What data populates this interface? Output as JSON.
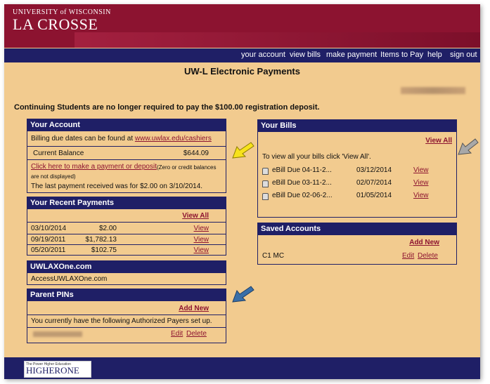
{
  "header": {
    "logo_top": "UNIVERSITY of WISCONSIN",
    "logo_main": "LA CROSSE"
  },
  "nav": [
    "your account",
    "view bills",
    "make payment",
    "Items to Pay",
    "help",
    "sign out"
  ],
  "page_title": "UW-L Electronic Payments",
  "notice": "Continuing Students are no longer required to pay the $100.00 registration deposit.",
  "your_account": {
    "title": "Your Account",
    "billing_prefix": "Billing due dates can be found at ",
    "billing_link": "www.uwlax.edu/cashiers",
    "balance_label": "Current Balance",
    "balance_value": "$644.09",
    "pay_link": "Click here to make a payment or deposit",
    "pay_note_1": "(Zero or credit balances",
    "pay_note_2": "are not displayed)",
    "last_payment": "The last payment received was for $2.00 on 3/10/2014."
  },
  "recent_payments": {
    "title": "Your Recent Payments",
    "view_all": "View All",
    "rows": [
      {
        "date": "03/10/2014",
        "amount": "$2.00",
        "action": "View"
      },
      {
        "date": "09/19/2011",
        "amount": "$1,782.13",
        "action": "View"
      },
      {
        "date": "05/20/2011",
        "amount": "$102.75",
        "action": "View"
      }
    ]
  },
  "uwlaxone": {
    "title": "UWLAXOne.com",
    "text": "AccessUWLAXOne.com"
  },
  "parent_pins": {
    "title": "Parent PINs",
    "add_new": "Add New",
    "text": "You currently have the following Authorized Payers set up.",
    "edit": "Edit",
    "delete": "Delete"
  },
  "your_bills": {
    "title": "Your Bills",
    "view_all": "View All",
    "intro": "To view all your bills click 'View All'.",
    "rows": [
      {
        "name": "eBill Due 04-11-2...",
        "date": "03/12/2014",
        "action": "View"
      },
      {
        "name": "eBill Due 03-11-2...",
        "date": "02/07/2014",
        "action": "View"
      },
      {
        "name": "eBill Due 02-06-2...",
        "date": "01/05/2014",
        "action": "View"
      }
    ]
  },
  "saved_accounts": {
    "title": "Saved Accounts",
    "add_new": "Add New",
    "row_name": "C1 MC",
    "edit": "Edit",
    "delete": "Delete"
  },
  "footer": {
    "logo_small": "The Power Higher Education",
    "logo_main": "HIGHERONE"
  },
  "colors": {
    "maroon": "#8c1330",
    "navy": "#1f1f66",
    "tan": "#f2cb8f",
    "arrow_yellow": "#f7e21b",
    "arrow_gray": "#a8a8a8",
    "arrow_blue": "#3a6fa8"
  }
}
